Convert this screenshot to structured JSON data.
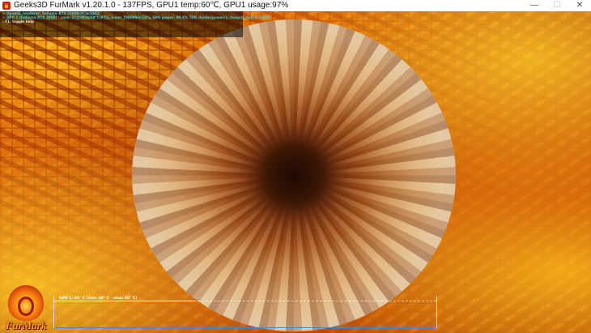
{
  "window": {
    "title": "Geeks3D FurMark v1.20.1.0 - 137FPS, GPU1 temp:60℃, GPU1 usage:97%",
    "controls": {
      "minimize": "—",
      "maximize": "☐",
      "close": "✕"
    }
  },
  "hud": {
    "lines": [
      "FurMark v1.20.1.0 - Burn-in test, 1920x1080 (0X MSAA)",
      "Frames:36427 - time:00:04:22 - FPS:137 (min:111, max:145, avg:138)",
      "> OpenGL renderer: GeForce RTX 2060S/PCIe/SSE2",
      "> GPU 1 (GeForce RTX 2060) - core: 1755MHz/60°C/97%, mem: 7000MHz/10%, GPU power: 90.8% TDP, limits:[power:1, temp:0, volt:0, OV:0]",
      "- F1: toggle help"
    ]
  },
  "graph": {
    "label": "GPU 1: 60° C (min: 40° C - max: 60° C)"
  },
  "logo": {
    "text": "FurMark"
  },
  "colors": {
    "hud_white": "#e8e8e8",
    "hud_cyan": "#3fd3e6",
    "graph_axis": "#3a8bd6",
    "logo_orange": "#ff9b1a"
  },
  "icons": {
    "app": "furmark-app-icon",
    "minimize": "minimize-icon",
    "maximize": "maximize-icon",
    "close": "close-icon"
  }
}
